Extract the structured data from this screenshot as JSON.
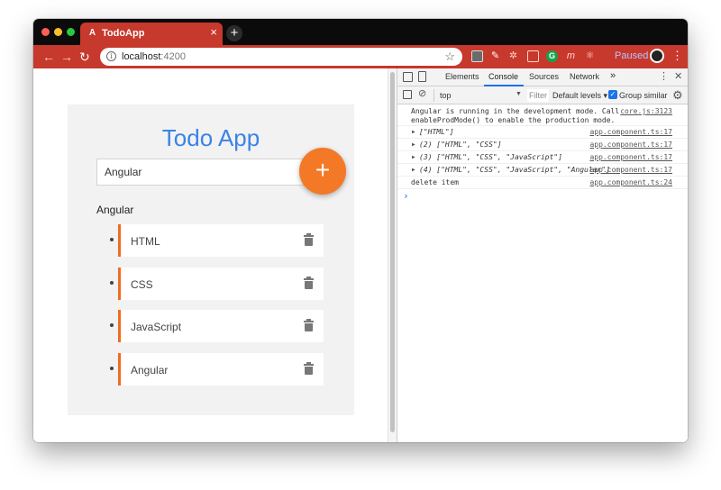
{
  "browser": {
    "tab_title": "TodoApp",
    "tab_favicon": "A",
    "close_glyph": "×",
    "new_tab_glyph": "+",
    "url_host": "localhost",
    "url_port": ":4200",
    "paused_label": "Paused",
    "accent_color": "#c6392c"
  },
  "app": {
    "title": "Todo App",
    "input_value": "Angular",
    "add_button_label": "+",
    "current_item_label": "Angular",
    "accent_color": "#f47926",
    "items": [
      {
        "label": "HTML"
      },
      {
        "label": "CSS"
      },
      {
        "label": "JavaScript"
      },
      {
        "label": "Angular"
      }
    ]
  },
  "devtools": {
    "tabs": [
      "Elements",
      "Console",
      "Sources",
      "Network"
    ],
    "active_tab": "Console",
    "more_tabs": "»",
    "context": "top",
    "filter_placeholder": "Filter",
    "levels_label": "Default levels ▾",
    "group_similar_label": "Group similar",
    "logs": [
      {
        "text": "Angular is running in the development mode. Call\nenableProdMode() to enable the production mode.",
        "source": "core.js:3123"
      },
      {
        "text": "[\"HTML\"]",
        "source": "app.component.ts:17"
      },
      {
        "text": "(2) [\"HTML\", \"CSS\"]",
        "source": "app.component.ts:17"
      },
      {
        "text": "(3) [\"HTML\", \"CSS\", \"JavaScript\"]",
        "source": "app.component.ts:17"
      },
      {
        "text": "(4) [\"HTML\", \"CSS\", \"JavaScript\", \"Angular\"]",
        "source": "app.component.ts:17"
      },
      {
        "text": "delete item",
        "source": "app.component.ts:24"
      }
    ],
    "prompt_glyph": "›"
  }
}
